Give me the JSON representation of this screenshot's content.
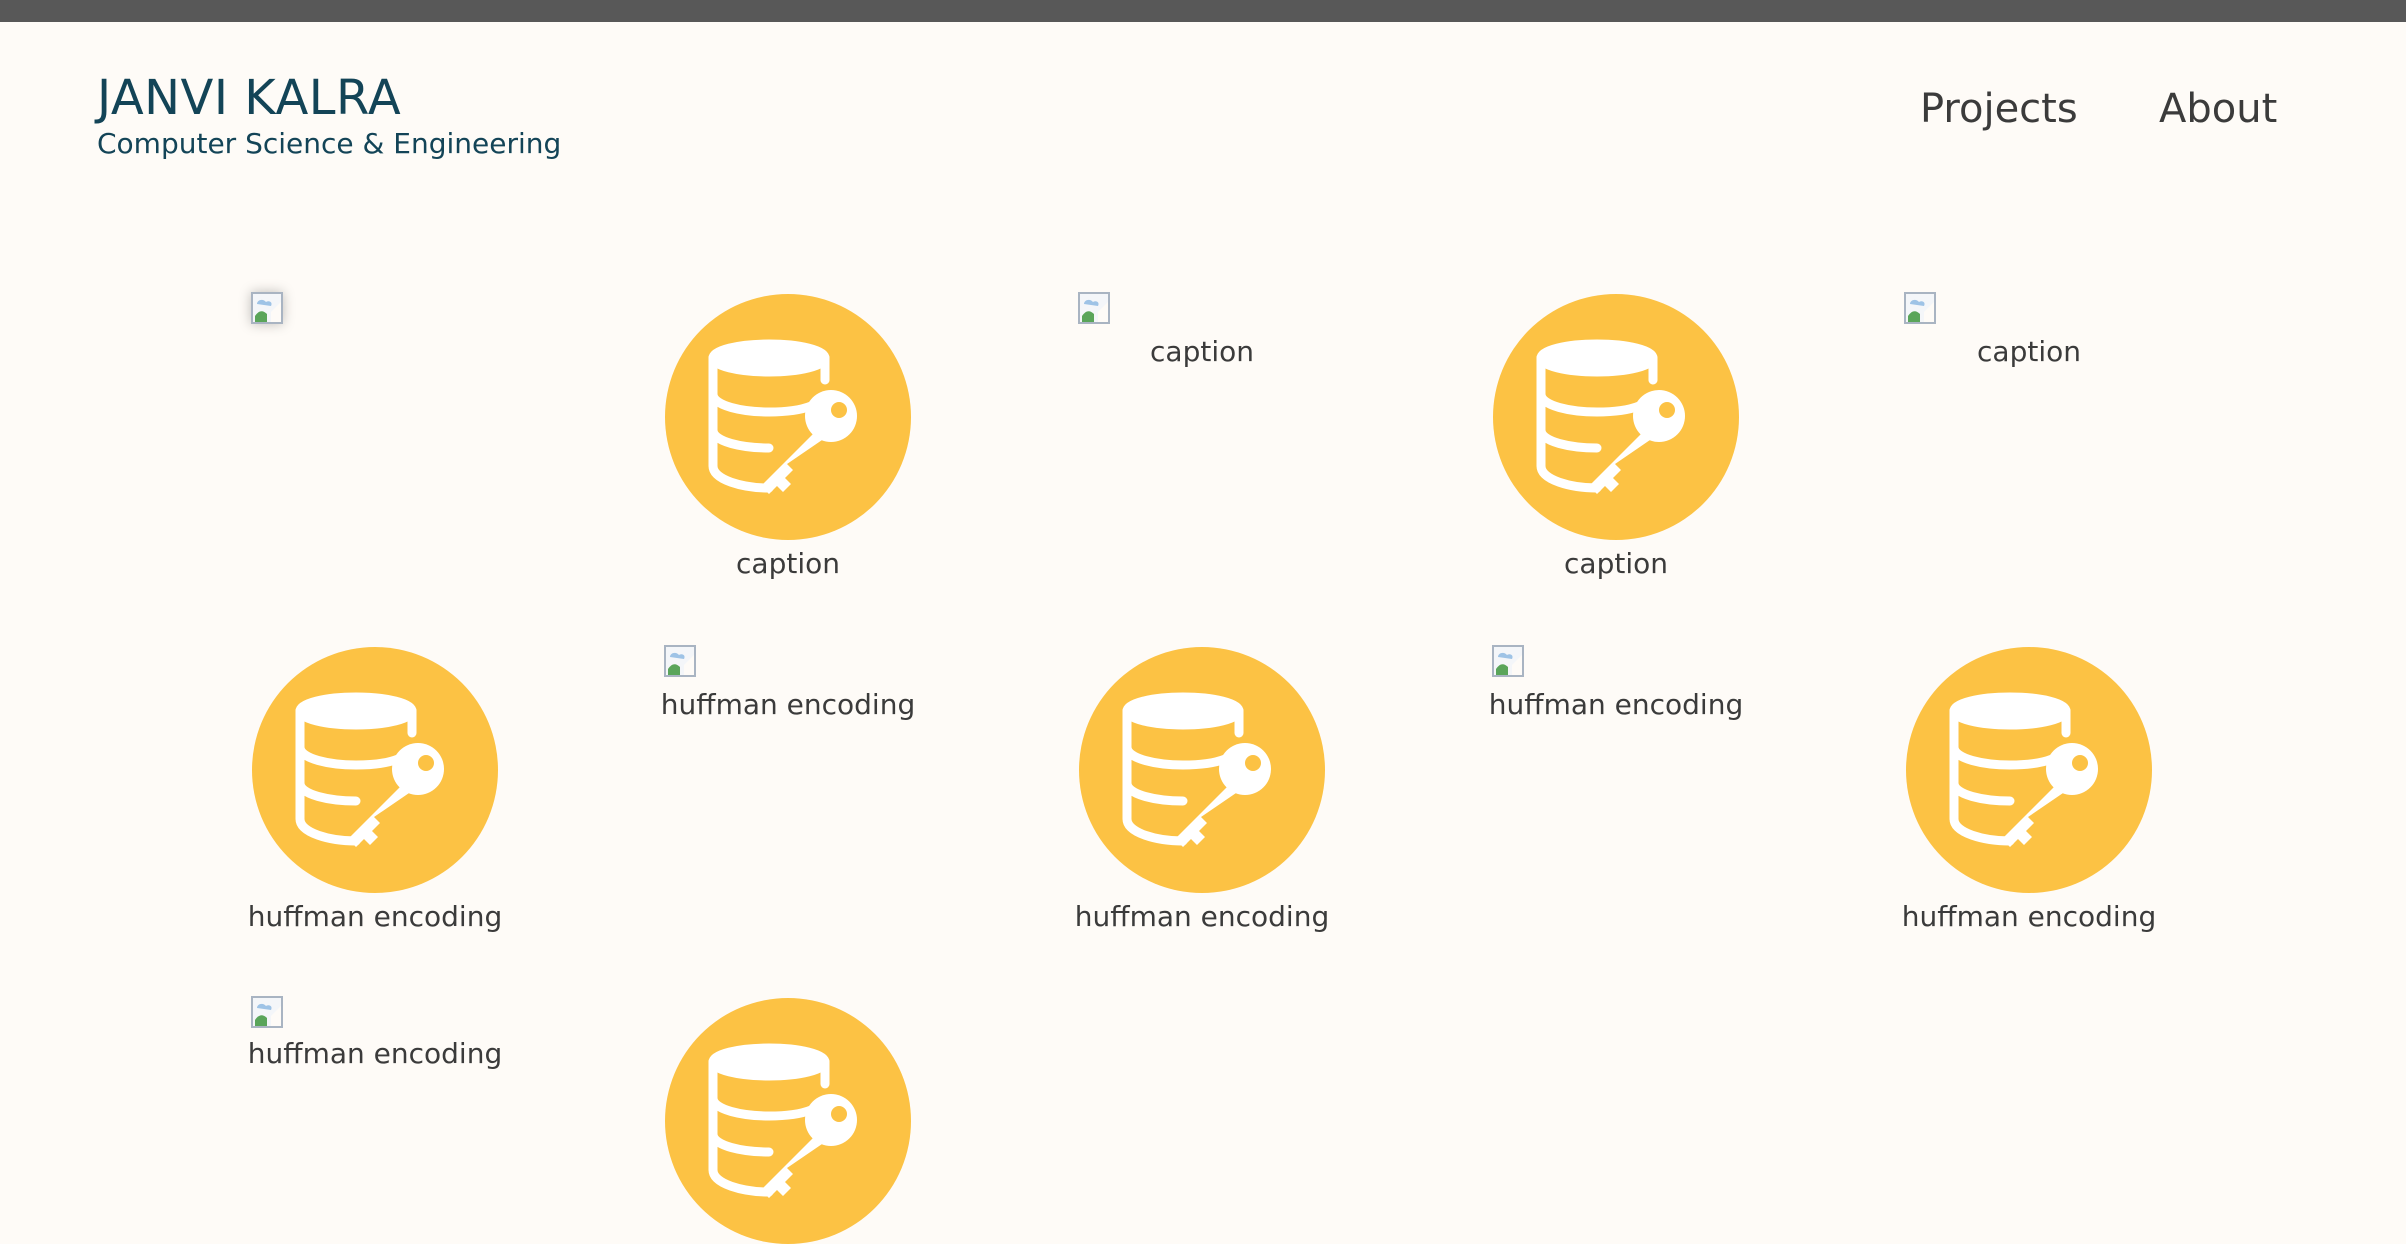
{
  "header": {
    "name": "JANVI KALRA",
    "subtitle": "Computer Science & Engineering",
    "nav": [
      {
        "label": "Projects"
      },
      {
        "label": "About"
      }
    ]
  },
  "tiles": [
    {
      "kind": "broken-image",
      "caption": ""
    },
    {
      "kind": "database-key-icon",
      "caption": "caption"
    },
    {
      "kind": "broken-image",
      "caption": "caption"
    },
    {
      "kind": "database-key-icon",
      "caption": "caption"
    },
    {
      "kind": "broken-image",
      "caption": "caption"
    },
    {
      "kind": "database-key-icon",
      "caption": "huffman encoding"
    },
    {
      "kind": "broken-image",
      "caption": "huffman encoding"
    },
    {
      "kind": "database-key-icon",
      "caption": "huffman encoding"
    },
    {
      "kind": "broken-image",
      "caption": "huffman encoding"
    },
    {
      "kind": "database-key-icon",
      "caption": "huffman encoding"
    },
    {
      "kind": "broken-image",
      "caption": "huffman encoding"
    },
    {
      "kind": "database-key-icon",
      "caption": ""
    }
  ],
  "colors": {
    "background": "#fefbf7",
    "topbar": "#585858",
    "brand": "#134457",
    "icon_circle": "#fcc244",
    "text": "#3b3b3b"
  }
}
